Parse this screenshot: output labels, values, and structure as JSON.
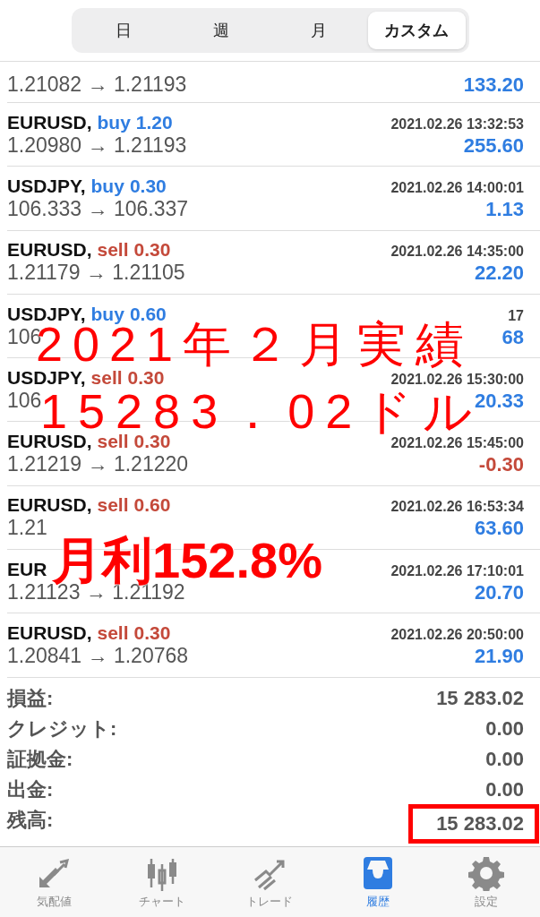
{
  "period_tabs": [
    {
      "label": "日",
      "selected": false
    },
    {
      "label": "週",
      "selected": false
    },
    {
      "label": "月",
      "selected": false
    },
    {
      "label": "カスタム",
      "selected": true
    }
  ],
  "partial_top_row": {
    "prices": "1.21082 → 1.21193",
    "profit": "133.20",
    "loss": false
  },
  "trades": [
    {
      "symbol": "EURUSD,",
      "kind": "buy",
      "side": "buy",
      "volume": "1.20",
      "time": "2021.02.26 13:32:53",
      "prices": "1.20980 → 1.21193",
      "profit": "255.60",
      "loss": false
    },
    {
      "symbol": "USDJPY,",
      "kind": "buy",
      "side": "buy",
      "volume": "0.30",
      "time": "2021.02.26 14:00:01",
      "prices": "106.333 → 106.337",
      "profit": "1.13",
      "loss": false
    },
    {
      "symbol": "EURUSD,",
      "kind": "sell",
      "side": "sell",
      "volume": "0.30",
      "time": "2021.02.26 14:35:00",
      "prices": "1.21179 → 1.21105",
      "profit": "22.20",
      "loss": false
    },
    {
      "symbol": "USDJPY,",
      "kind": "buy",
      "side": "buy",
      "volume": "0.60",
      "time": "17",
      "prices": "106",
      "profit": "68",
      "loss": false
    },
    {
      "symbol": "USDJPY,",
      "kind": "sell",
      "side": "sell",
      "volume": "0.30",
      "time": "2021.02.26 15:30:00",
      "prices": "106",
      "profit": "20.33",
      "loss": false
    },
    {
      "symbol": "EURUSD,",
      "kind": "sell",
      "side": "sell",
      "volume": "0.30",
      "time": "2021.02.26 15:45:00",
      "prices": "1.21219 → 1.21220",
      "profit": "-0.30",
      "loss": true
    },
    {
      "symbol": "EURUSD,",
      "kind": "sell",
      "side": "sell",
      "volume": "0.60",
      "time": "2021.02.26 16:53:34",
      "prices": "1.21",
      "profit": "63.60",
      "loss": false
    },
    {
      "symbol": "EUR",
      "time": "2021.02.26 17:10:01",
      "prices": "1.21123 → 1.21192",
      "profit": "20.70",
      "loss": false
    },
    {
      "symbol": "EURUSD,",
      "kind": "sell",
      "side": "sell",
      "volume": "0.30",
      "time": "2021.02.26 20:50:00",
      "prices": "1.20841 → 1.20768",
      "profit": "21.90",
      "loss": false
    }
  ],
  "summary": [
    {
      "label": "損益:",
      "value": "15 283.02",
      "highlighted": false
    },
    {
      "label": "クレジット:",
      "value": "0.00",
      "highlighted": false
    },
    {
      "label": "証拠金:",
      "value": "0.00",
      "highlighted": false
    },
    {
      "label": "出金:",
      "value": "0.00",
      "highlighted": false
    },
    {
      "label": "残高:",
      "value": "15 283.02",
      "highlighted": true
    }
  ],
  "overlay": [
    "2021年２月実績",
    "15283．02ドル",
    "月利152.8%"
  ],
  "tab_bar": [
    {
      "kind": "quotes",
      "label": "気配値",
      "selected": false
    },
    {
      "kind": "chart",
      "label": "チャート",
      "selected": false
    },
    {
      "kind": "trade",
      "label": "トレード",
      "selected": false
    },
    {
      "kind": "history",
      "label": "履歴",
      "selected": true
    },
    {
      "kind": "settings",
      "label": "設定",
      "selected": false
    }
  ]
}
